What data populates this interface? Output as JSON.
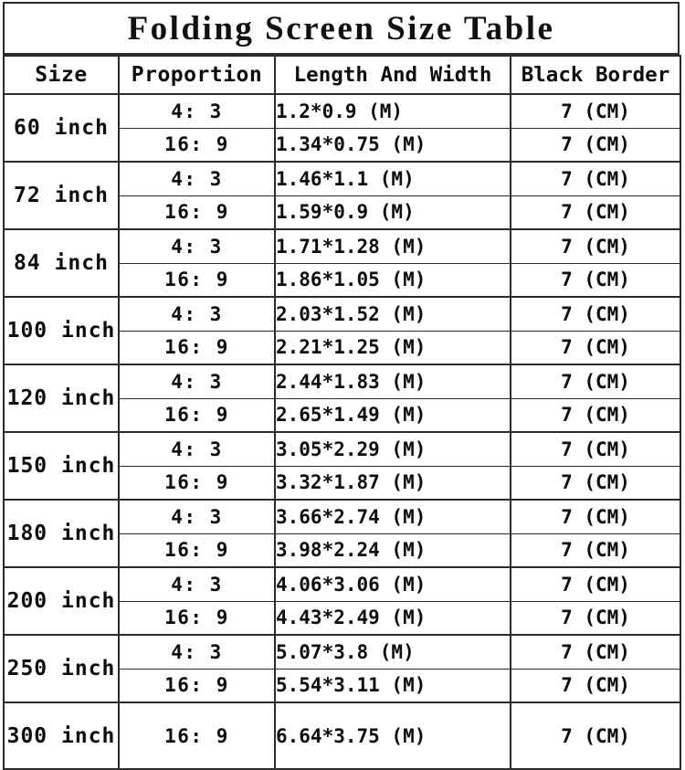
{
  "title": "Folding Screen Size Table",
  "table": {
    "headers": {
      "size": "Size",
      "proportion": "Proportion",
      "length_and_width": "Length And Width",
      "black_border": "Black Border"
    },
    "unit_length": "(M)",
    "unit_border": "(CM)",
    "rows": [
      {
        "size": "60 inch",
        "entries": [
          {
            "proportion": "4: 3",
            "length_and_width": "1.2*0.9  (M)",
            "black_border": "7 (CM)"
          },
          {
            "proportion": "16: 9",
            "length_and_width": "1.34*0.75 (M)",
            "black_border": "7 (CM)"
          }
        ]
      },
      {
        "size": "72 inch",
        "entries": [
          {
            "proportion": "4: 3",
            "length_and_width": "1.46*1.1 (M)",
            "black_border": "7 (CM)"
          },
          {
            "proportion": "16: 9",
            "length_and_width": "1.59*0.9 (M)",
            "black_border": "7 (CM)"
          }
        ]
      },
      {
        "size": "84 inch",
        "entries": [
          {
            "proportion": "4: 3",
            "length_and_width": "1.71*1.28 (M)",
            "black_border": "7 (CM)"
          },
          {
            "proportion": "16: 9",
            "length_and_width": "1.86*1.05 (M)",
            "black_border": "7 (CM)"
          }
        ]
      },
      {
        "size": "100 inch",
        "entries": [
          {
            "proportion": "4: 3",
            "length_and_width": "2.03*1.52 (M)",
            "black_border": "7 (CM)"
          },
          {
            "proportion": "16: 9",
            "length_and_width": "2.21*1.25 (M)",
            "black_border": "7 (CM)"
          }
        ]
      },
      {
        "size": "120 inch",
        "entries": [
          {
            "proportion": "4: 3",
            "length_and_width": "2.44*1.83 (M)",
            "black_border": "7 (CM)"
          },
          {
            "proportion": "16: 9",
            "length_and_width": "2.65*1.49 (M)",
            "black_border": "7 (CM)"
          }
        ]
      },
      {
        "size": "150 inch",
        "entries": [
          {
            "proportion": "4: 3",
            "length_and_width": "3.05*2.29 (M)",
            "black_border": "7 (CM)"
          },
          {
            "proportion": "16: 9",
            "length_and_width": "3.32*1.87 (M)",
            "black_border": "7 (CM)"
          }
        ]
      },
      {
        "size": "180 inch",
        "entries": [
          {
            "proportion": "4: 3",
            "length_and_width": "3.66*2.74 (M)",
            "black_border": "7 (CM)"
          },
          {
            "proportion": "16: 9",
            "length_and_width": "3.98*2.24 (M)",
            "black_border": "7 (CM)"
          }
        ]
      },
      {
        "size": "200 inch",
        "entries": [
          {
            "proportion": "4: 3",
            "length_and_width": "4.06*3.06 (M)",
            "black_border": "7 (CM)"
          },
          {
            "proportion": "16: 9",
            "length_and_width": "4.43*2.49 (M)",
            "black_border": "7 (CM)"
          }
        ]
      },
      {
        "size": "250 inch",
        "entries": [
          {
            "proportion": "4: 3",
            "length_and_width": "5.07*3.8 (M)",
            "black_border": "7 (CM)"
          },
          {
            "proportion": "16: 9",
            "length_and_width": "5.54*3.11 (M)",
            "black_border": "7 (CM)"
          }
        ]
      },
      {
        "size": "300 inch",
        "entries": [
          {
            "proportion": "16: 9",
            "length_and_width": "6.64*3.75 (M)",
            "black_border": "7 (CM)"
          }
        ]
      }
    ]
  },
  "colors": {
    "border": "#2b2b2b",
    "text": "#0d0d0d",
    "background": "#ffffff"
  }
}
